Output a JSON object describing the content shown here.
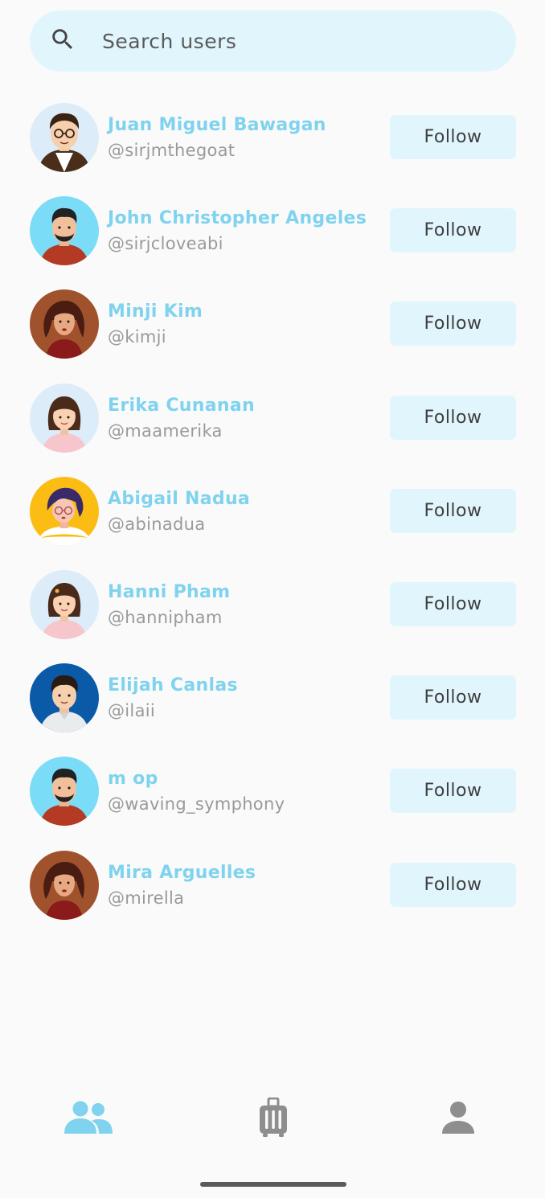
{
  "search": {
    "placeholder": "Search users"
  },
  "users": [
    {
      "name": "Juan Miguel Bawagan",
      "handle": "@sirjmthegoat",
      "follow_label": "Follow",
      "avatar": "man-glasses-avatar-icon"
    },
    {
      "name": "John Christopher Angeles",
      "handle": "@sirjcloveabi",
      "follow_label": "Follow",
      "avatar": "man-beard-avatar-icon"
    },
    {
      "name": "Minji Kim",
      "handle": "@kimji",
      "follow_label": "Follow",
      "avatar": "woman-curly-hair-avatar-icon"
    },
    {
      "name": "Erika Cunanan",
      "handle": "@maamerika",
      "follow_label": "Follow",
      "avatar": "woman-avatar-icon"
    },
    {
      "name": "Abigail Nadua",
      "handle": "@abinadua",
      "follow_label": "Follow",
      "avatar": "woman-glasses-avatar-icon"
    },
    {
      "name": "Hanni Pham",
      "handle": "@hannipham",
      "follow_label": "Follow",
      "avatar": "woman-avatar-icon"
    },
    {
      "name": "Elijah Canlas",
      "handle": "@ilaii",
      "follow_label": "Follow",
      "avatar": "man-avatar-icon"
    },
    {
      "name": "m op",
      "handle": "@waving_symphony",
      "follow_label": "Follow",
      "avatar": "man-beard-avatar-icon"
    },
    {
      "name": "Mira Arguelles",
      "handle": "@mirella",
      "follow_label": "Follow",
      "avatar": "woman-curly-hair-avatar-icon"
    }
  ],
  "bottom_nav": [
    {
      "icon": "people-icon",
      "active": true
    },
    {
      "icon": "luggage-icon",
      "active": false
    },
    {
      "icon": "person-icon",
      "active": false
    }
  ],
  "colors": {
    "accent": "#7fd3ee",
    "search_bg": "#e1f5fd",
    "button_bg": "#e1f5fd",
    "handle": "#9a9a9a",
    "inactive_icon": "#8e8e8e"
  }
}
